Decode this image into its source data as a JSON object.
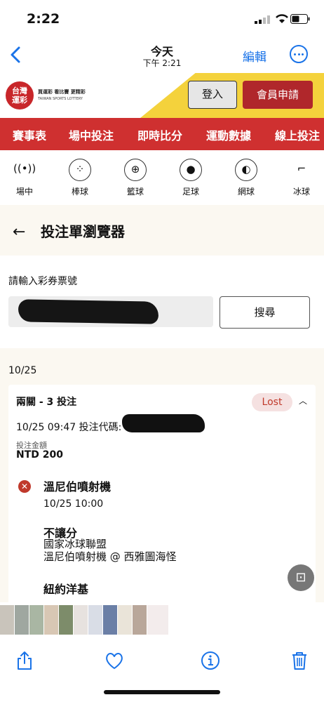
{
  "status_bar": {
    "time": "2:22"
  },
  "photos_nav": {
    "title": "今天",
    "subtitle": "下午 2:21",
    "edit_label": "編輯"
  },
  "site": {
    "logo_line1": "台灣",
    "logo_line2": "運彩",
    "logo_slogan": "買運彩 看比賽 更精彩",
    "logo_english": "TAIWAN SPORTS LOTTERY",
    "login_label": "登入",
    "register_label": "會員申請"
  },
  "main_nav": [
    "賽事表",
    "場中投注",
    "即時比分",
    "運動數據",
    "線上投注"
  ],
  "sports": [
    {
      "label": "場中",
      "icon": "live-icon"
    },
    {
      "label": "棒球",
      "icon": "baseball-icon"
    },
    {
      "label": "籃球",
      "icon": "basketball-icon"
    },
    {
      "label": "足球",
      "icon": "soccer-icon"
    },
    {
      "label": "網球",
      "icon": "tennis-icon"
    },
    {
      "label": "冰球",
      "icon": "hockey-icon"
    }
  ],
  "browser": {
    "title": "投注單瀏覽器",
    "input_label": "請輸入彩券票號",
    "search_label": "搜尋"
  },
  "bets": {
    "date_header": "10/25",
    "card": {
      "title": "兩關 - 3 投注",
      "status": "Lost",
      "placed_line": "10/25 09:47 投注代碼: 1",
      "amount_label": "投注金額",
      "amount_value": "NTD 200",
      "selection": {
        "team": "溫尼伯噴射機",
        "time": "10/25 10:00",
        "market": "不讓分",
        "league": "國家冰球聯盟",
        "match": "溫尼伯噴射機 @ 西雅圖海怪"
      },
      "next_team": "紐約洋基"
    }
  },
  "colors": {
    "brand_red": "#cf3030",
    "accent_blue": "#1a73e8",
    "lost_red": "#c0392b"
  }
}
